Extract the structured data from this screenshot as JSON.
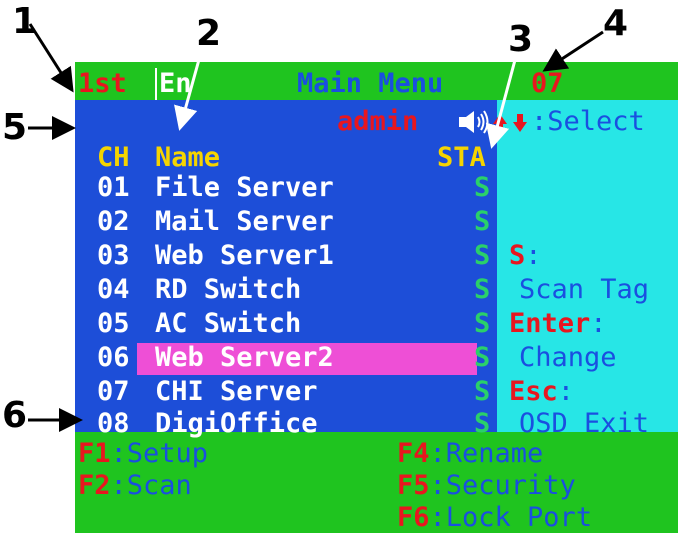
{
  "callouts": [
    "1",
    "2",
    "3",
    "4",
    "5",
    "6"
  ],
  "title_bar": {
    "user_level": "1st",
    "language": "En",
    "menu_title": "Main Menu",
    "port_number": "07"
  },
  "user_row": {
    "username": "admin",
    "speaker_icon": "speaker-icon",
    "arrows_icon": "up-down-arrows-icon",
    "select_label": ":Select"
  },
  "table": {
    "headers": {
      "ch": "CH",
      "name": "Name",
      "sta": "STA"
    },
    "rows": [
      {
        "ch": "01",
        "name": "File Server",
        "status": "S"
      },
      {
        "ch": "02",
        "name": "Mail Server",
        "status": "S"
      },
      {
        "ch": "03",
        "name": "Web Server1",
        "status": "S"
      },
      {
        "ch": "04",
        "name": "RD Switch",
        "status": "S"
      },
      {
        "ch": "05",
        "name": "AC Switch",
        "status": "S"
      },
      {
        "ch": "06",
        "name": "Web Server2",
        "status": "S"
      },
      {
        "ch": "07",
        "name": "CHI Server",
        "status": "S"
      },
      {
        "ch": "08",
        "name": "DigiOffice",
        "status": "S"
      }
    ],
    "selected_row": "06"
  },
  "help": {
    "s_key": "S",
    "s_desc": "Scan Tag",
    "enter_key": "Enter",
    "enter_desc": "Change",
    "esc_key": "Esc",
    "esc_desc": "OSD Exit",
    "colon": ":"
  },
  "function_keys": {
    "f1": {
      "key": "F1",
      "label": ":Setup"
    },
    "f2": {
      "key": "F2",
      "label": ":Scan"
    },
    "f4": {
      "key": "F4",
      "label": ":Rename"
    },
    "f5": {
      "key": "F5",
      "label": ":Security"
    },
    "f6": {
      "key": "F6",
      "label": ":Lock Port"
    }
  },
  "colors": {
    "osd_green": "#1fc41f",
    "list_blue": "#1d4ed8",
    "help_cyan": "#27e6e6",
    "highlight_magenta": "#ee4fd6",
    "key_red": "#e8161f",
    "header_yellow": "#f5d400"
  }
}
